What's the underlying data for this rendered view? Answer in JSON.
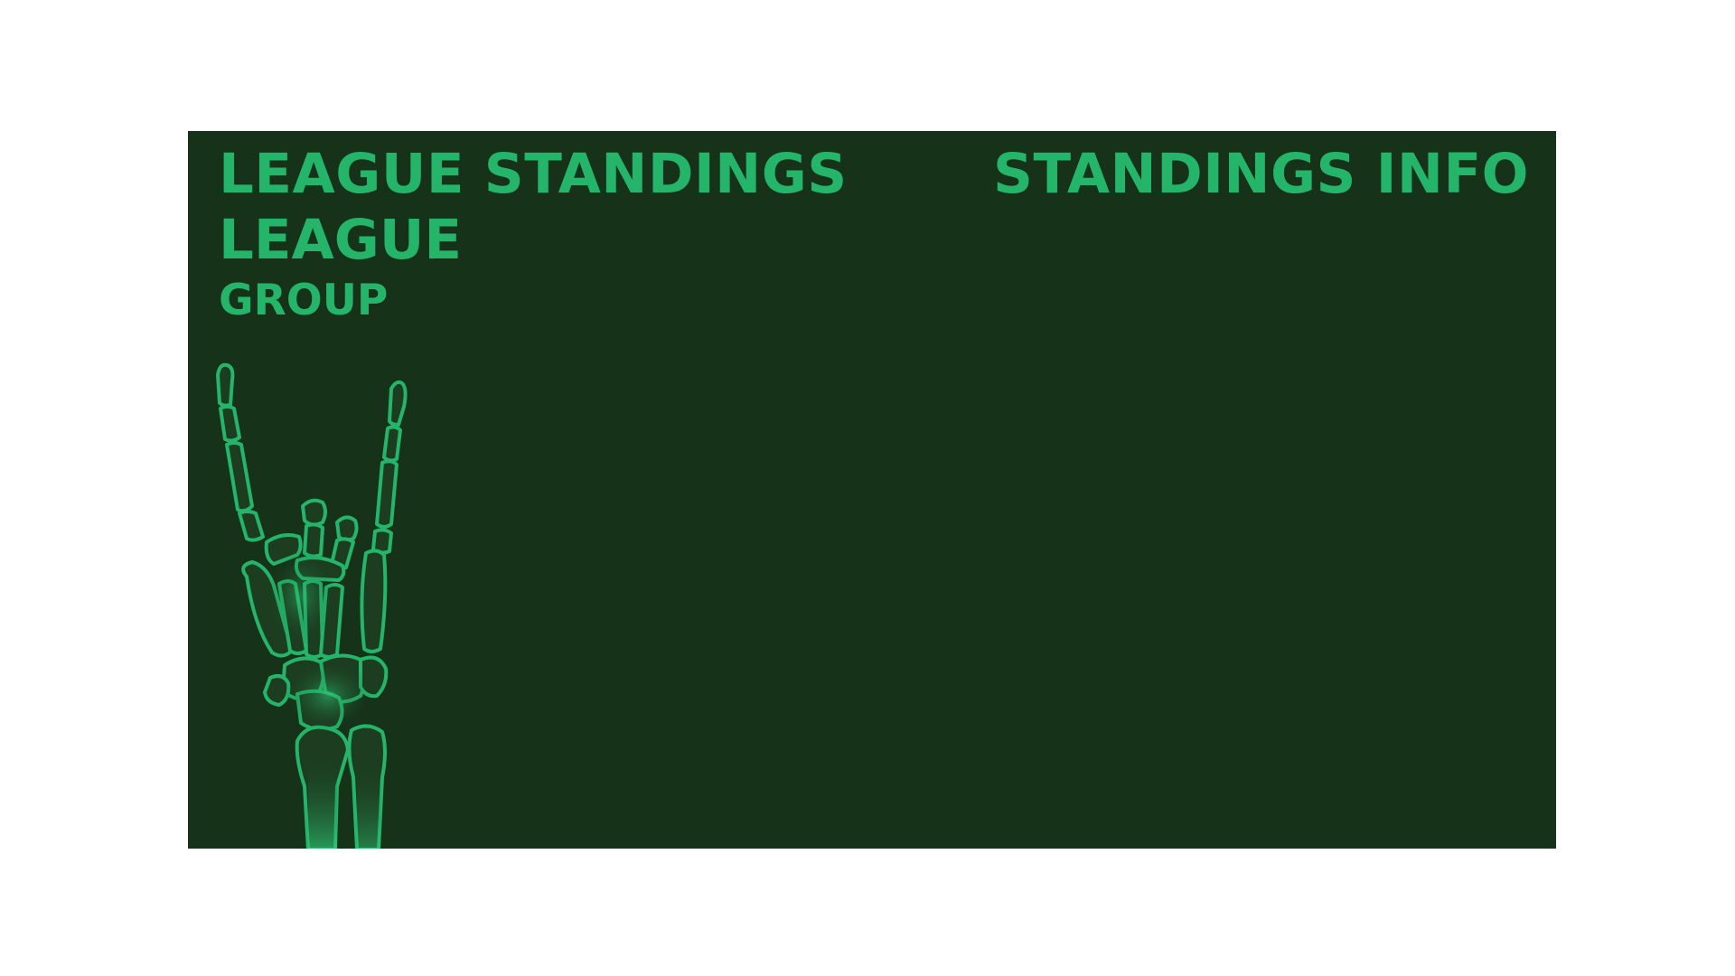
{
  "header": {
    "title": "LEAGUE STANDINGS",
    "info_title": "STANDINGS INFO"
  },
  "league": {
    "name": "LEAGUE",
    "group": "GROUP"
  },
  "decoration": {
    "icon": "skeleton-rock-hand-icon"
  },
  "colors": {
    "background": "#163218",
    "accent": "#24b56b",
    "page": "#ffffff"
  }
}
